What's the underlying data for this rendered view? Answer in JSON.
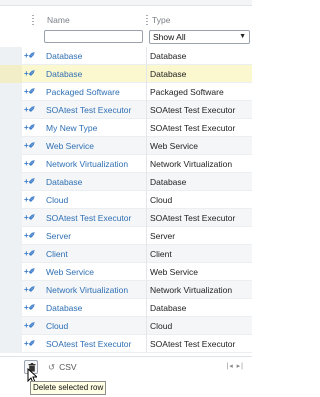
{
  "table": {
    "columns": [
      {
        "label": "Name"
      },
      {
        "label": "Type"
      }
    ],
    "filter": {
      "name_value": "",
      "type_selected": "Show All"
    },
    "add_icon_glyph": "+✐",
    "rows": [
      {
        "name": "Database",
        "type": "Database",
        "selected": false
      },
      {
        "name": "Database",
        "type": "Database",
        "selected": true
      },
      {
        "name": "Packaged Software",
        "type": "Packaged Software",
        "selected": false
      },
      {
        "name": "SOAtest Test Executor",
        "type": "SOAtest Test Executor",
        "selected": false
      },
      {
        "name": "My New Type",
        "type": "SOAtest Test Executor",
        "selected": false
      },
      {
        "name": "Web Service",
        "type": "Web Service",
        "selected": false
      },
      {
        "name": "Network Virtualization",
        "type": "Network Virtualization",
        "selected": false
      },
      {
        "name": "Database",
        "type": "Database",
        "selected": false
      },
      {
        "name": "Cloud",
        "type": "Cloud",
        "selected": false
      },
      {
        "name": "SOAtest Test Executor",
        "type": "SOAtest Test Executor",
        "selected": false
      },
      {
        "name": "Server",
        "type": "Server",
        "selected": false
      },
      {
        "name": "Client",
        "type": "Client",
        "selected": false
      },
      {
        "name": "Web Service",
        "type": "Web Service",
        "selected": false
      },
      {
        "name": "Network Virtualization",
        "type": "Network Virtualization",
        "selected": false
      },
      {
        "name": "Database",
        "type": "Database",
        "selected": false
      },
      {
        "name": "Cloud",
        "type": "Cloud",
        "selected": false
      },
      {
        "name": "SOAtest Test Executor",
        "type": "SOAtest Test Executor",
        "selected": false
      }
    ]
  },
  "footer": {
    "csv_label": "CSV",
    "pager_glyph": "|◂ ▸|"
  },
  "tooltip": {
    "text": "Delete selected row"
  },
  "colors": {
    "link": "#2f6fb3",
    "selected_row": "#fbf7cf"
  }
}
